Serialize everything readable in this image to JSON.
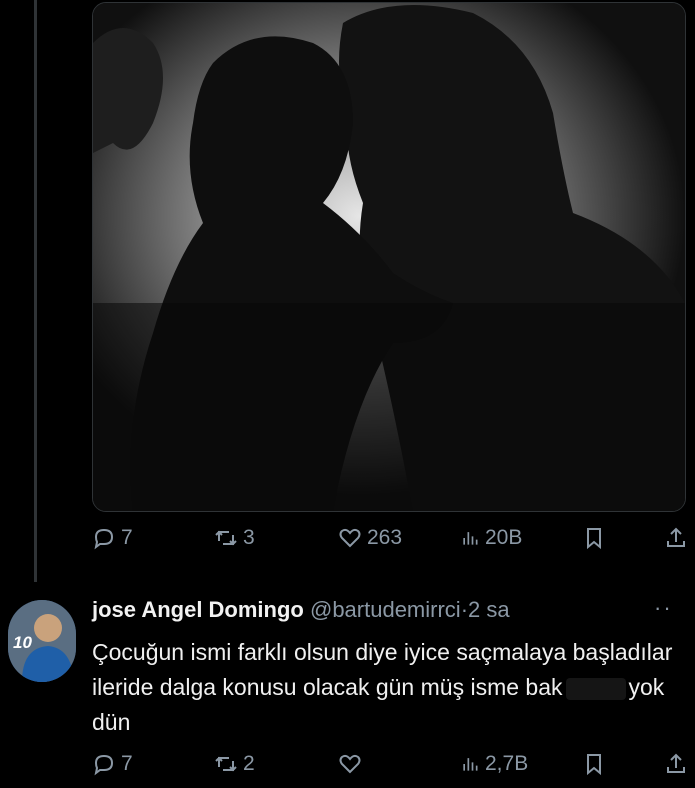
{
  "tweet": {
    "actions": {
      "replies": "7",
      "reposts": "3",
      "likes": "263",
      "views": "20B"
    }
  },
  "reply": {
    "display_name": "jose Angel Domingo",
    "handle": "@bartudemirrci",
    "separator": "·",
    "time": "2 sa",
    "avatar_number": "10",
    "text_part1": "Çocuğun ismi farklı olsun diye iyice saçmalaya başladılar ileride dalga konusu olacak gün müş isme bak",
    "text_part2": "yok dün",
    "actions": {
      "replies": "7",
      "reposts": "2",
      "likes": "",
      "views": "2,7B"
    }
  },
  "icons": {
    "reply": "reply-icon",
    "repost": "repost-icon",
    "like": "heart-icon",
    "views": "views-icon",
    "bookmark": "bookmark-icon",
    "share": "share-icon",
    "more": "more-icon"
  },
  "colors": {
    "background": "#000000",
    "muted": "#8b98a5",
    "text": "#e7e9ea"
  }
}
